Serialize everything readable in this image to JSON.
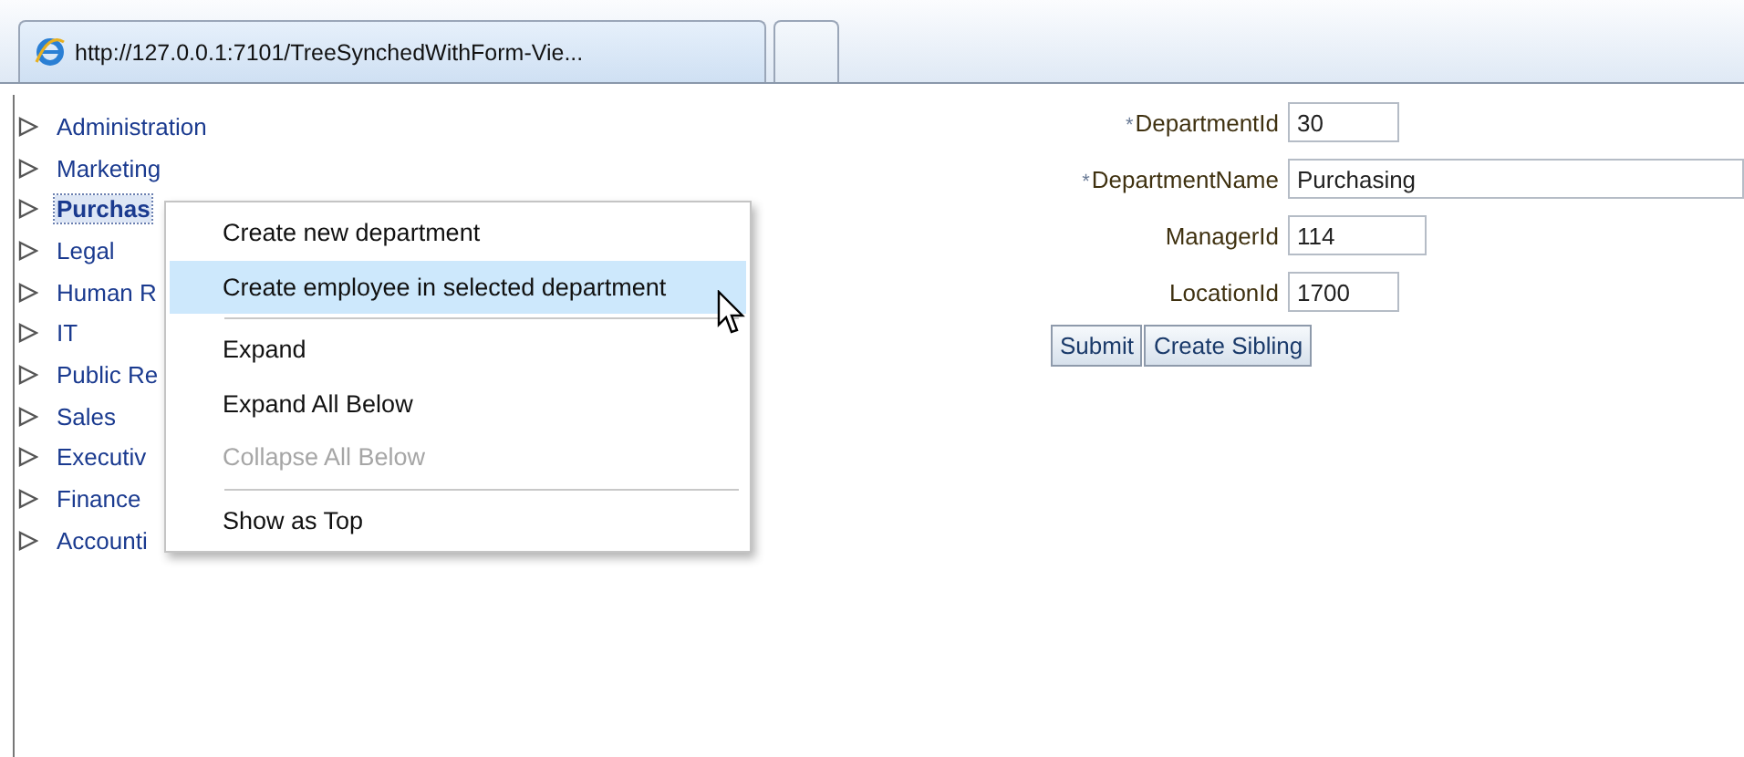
{
  "tabs": [
    {
      "label": "http://127.0.0.1:7101/TreeSynchedWithForm-Vie...",
      "selected": true
    },
    {
      "selected": false
    }
  ],
  "tree": {
    "items": [
      {
        "label": "Administration",
        "selected": false
      },
      {
        "label": "Marketing",
        "selected": false
      },
      {
        "label": "Purchas",
        "selected": true
      },
      {
        "label": "Legal",
        "selected": false
      },
      {
        "label": "Human R",
        "selected": false
      },
      {
        "label": "IT",
        "selected": false
      },
      {
        "label": "Public Re",
        "selected": false
      },
      {
        "label": "Sales",
        "selected": false
      },
      {
        "label": "Executiv",
        "selected": false
      },
      {
        "label": "Finance",
        "selected": false
      },
      {
        "label": "Accounti",
        "selected": false
      }
    ]
  },
  "context_menu": {
    "items": [
      {
        "kind": "item",
        "label": "Create new department",
        "selected": false,
        "disabled": false
      },
      {
        "kind": "item",
        "label": "Create employee in selected department",
        "selected": true,
        "disabled": false
      },
      {
        "kind": "separator"
      },
      {
        "kind": "item",
        "label": "Expand",
        "selected": false,
        "disabled": false
      },
      {
        "kind": "item",
        "label": "Expand All Below",
        "selected": false,
        "disabled": false
      },
      {
        "kind": "item",
        "label": "Collapse All Below",
        "selected": false,
        "disabled": true
      },
      {
        "kind": "separator"
      },
      {
        "kind": "item",
        "label": "Show as Top",
        "selected": false,
        "disabled": false
      }
    ]
  },
  "form": {
    "fields": [
      {
        "required_mark": "*",
        "label": "DepartmentId",
        "value": "30"
      },
      {
        "required_mark": "*",
        "label": "DepartmentName",
        "value": "Purchasing"
      },
      {
        "label": "ManagerId",
        "value": "114"
      },
      {
        "label": "LocationId",
        "value": "1700"
      }
    ],
    "buttons": [
      "Submit",
      "Create Sibling"
    ]
  }
}
